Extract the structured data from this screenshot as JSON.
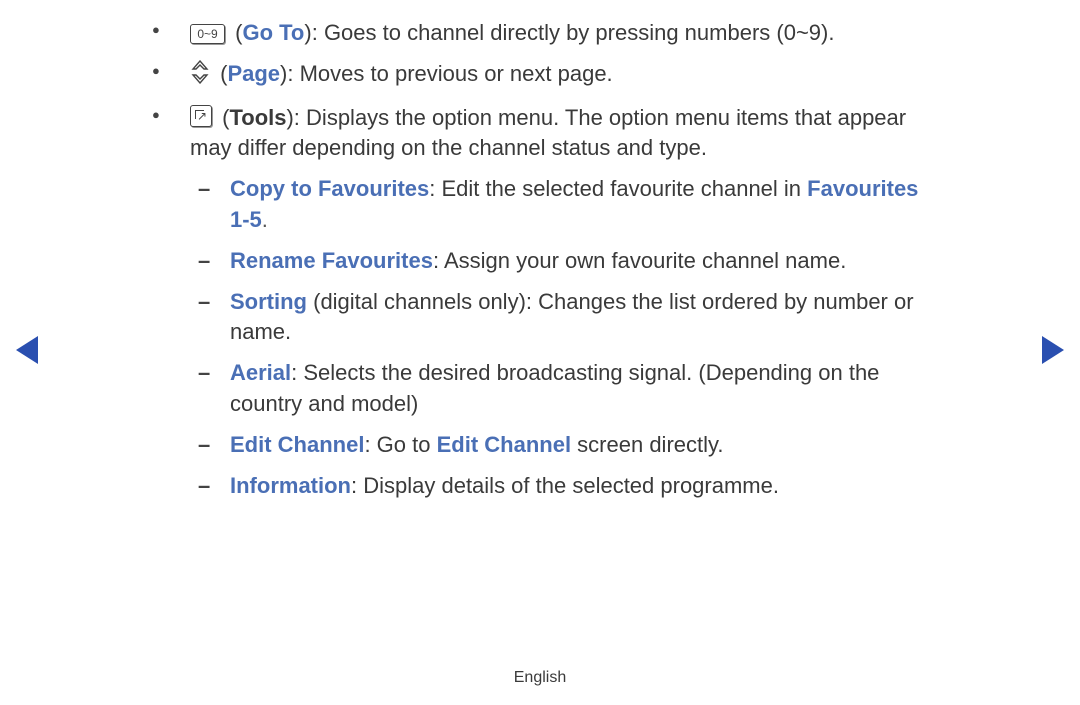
{
  "icons": {
    "numeric_label": "0~9"
  },
  "bullets": {
    "goto": {
      "label": "Go To",
      "desc": "Goes to channel directly by pressing numbers (0~9)."
    },
    "page": {
      "label": "Page",
      "desc": "Moves to previous or next page."
    },
    "tools": {
      "label": "Tools",
      "desc": "Displays the option menu. The option menu items that appear may differ depending on the channel status and type."
    }
  },
  "sub": {
    "copy_fav": {
      "label": "Copy to Favourites",
      "desc_pre": ": Edit the selected favourite channel in ",
      "ref": "Favourites 1-5"
    },
    "rename_fav": {
      "label": "Rename Favourites",
      "desc": ": Assign your own favourite channel name."
    },
    "sorting": {
      "label": "Sorting",
      "note": " (digital channels only)",
      "desc": ": Changes the list ordered by number or name."
    },
    "aerial": {
      "label": "Aerial",
      "desc": ": Selects the desired broadcasting signal. (Depending on the country and model)"
    },
    "edit_channel": {
      "label": "Edit Channel",
      "pre": ": Go to ",
      "ref": "Edit Channel",
      "post": " screen directly."
    },
    "information": {
      "label": "Information",
      "desc": ": Display details of the selected programme."
    }
  },
  "footer": {
    "language": "English"
  }
}
